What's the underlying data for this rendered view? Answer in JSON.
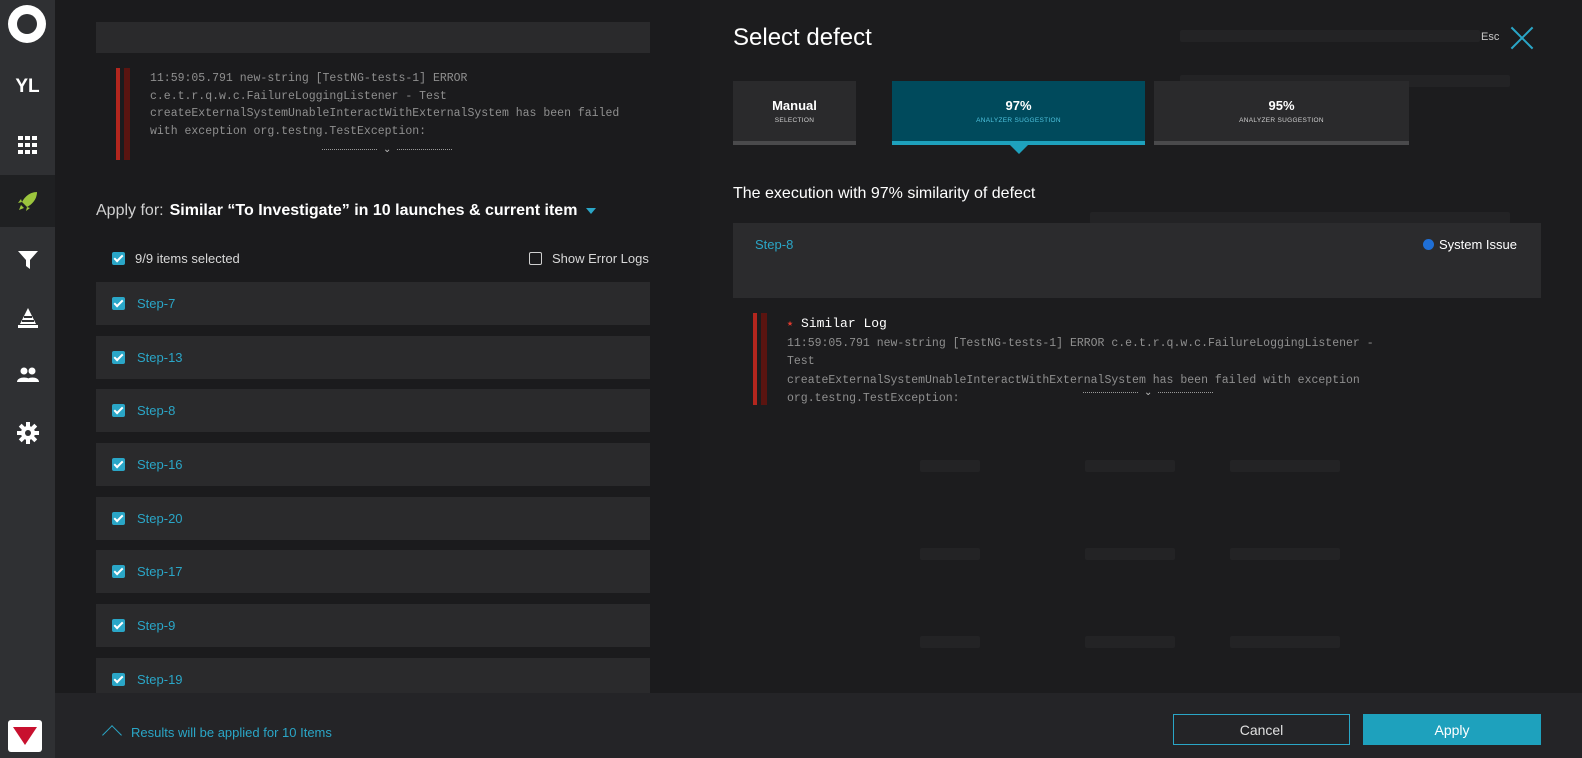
{
  "sidebar": {
    "items": [
      {
        "icon": "user-initials",
        "label": "YL"
      },
      {
        "icon": "grid-icon"
      },
      {
        "icon": "rocket-icon"
      },
      {
        "icon": "filter-icon"
      },
      {
        "icon": "widgets-icon"
      },
      {
        "icon": "members-icon"
      },
      {
        "icon": "gear-icon"
      }
    ],
    "active": "rocket-icon"
  },
  "left": {
    "log_lines": [
      "11:59:05.791 new-string [TestNG-tests-1] ERROR",
      "c.e.t.r.q.w.c.FailureLoggingListener - Test",
      "createExternalSystemUnableInteractWithExternalSystem has been failed",
      "with exception org.testng.TestException:"
    ],
    "apply_for_label": "Apply for:",
    "apply_for_value": "Similar “To Investigate” in 10 launches & current item",
    "selected_count": "9/9 items selected",
    "show_error_logs": "Show Error Logs",
    "items": [
      "Step-7",
      "Step-13",
      "Step-8",
      "Step-16",
      "Step-20",
      "Step-17",
      "Step-9",
      "Step-19"
    ]
  },
  "modal": {
    "title": "Select defect",
    "esc": "Esc",
    "tabs": [
      {
        "main": "Manual",
        "sub": "SELECTION"
      },
      {
        "main": "97%",
        "sub": "ANALYZER SUGGESTION"
      },
      {
        "main": "95%",
        "sub": "ANALYZER SUGGESTION"
      }
    ],
    "active_tab": 1,
    "similarity_text": "The execution with 97% similarity of defect",
    "card": {
      "step": "Step-8",
      "issue": "System Issue",
      "issue_color": "#1f6fd6"
    },
    "similar_log_title": "Similar Log",
    "similar_log_lines": [
      "11:59:05.791 new-string [TestNG-tests-1] ERROR c.e.t.r.q.w.c.FailureLoggingListener - Test",
      "createExternalSystemUnableInteractWithExternalSystem has been failed with exception",
      "org.testng.TestException:"
    ]
  },
  "footer": {
    "info": "Results will be applied for 10 Items",
    "cancel": "Cancel",
    "apply": "Apply"
  },
  "colors": {
    "accent": "#2aa6c7",
    "error": "#b3261e",
    "system_issue": "#1f6fd6"
  }
}
